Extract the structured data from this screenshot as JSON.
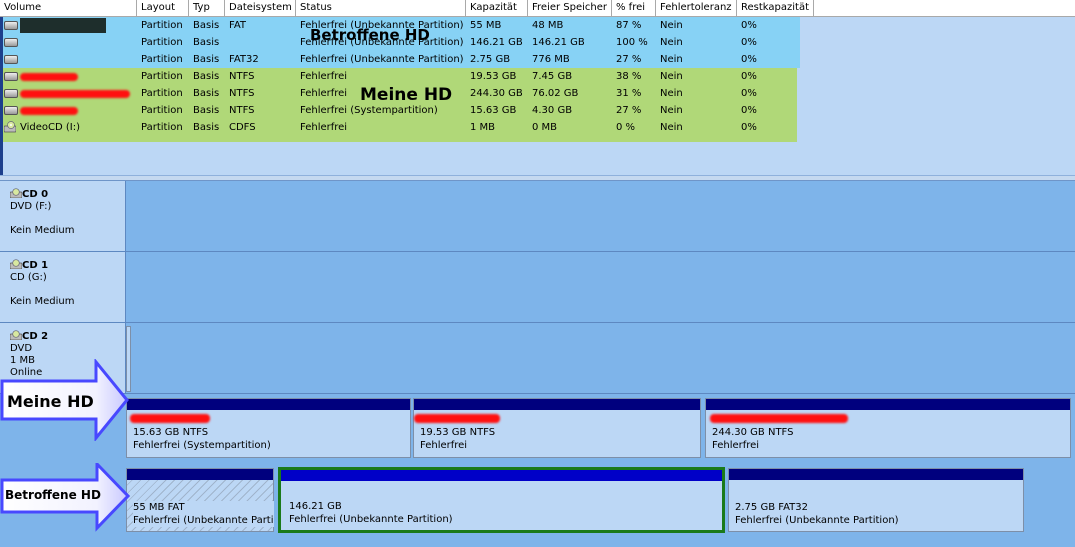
{
  "columns": [
    "Volume",
    "Layout",
    "Typ",
    "Dateisystem",
    "Status",
    "Kapazität",
    "Freier Speicher",
    "% frei",
    "Fehlertoleranz",
    "Restkapazität"
  ],
  "volumes": [
    {
      "volume": "",
      "layout": "Partition",
      "type": "Basis",
      "fs": "FAT",
      "status": "Fehlerfrei (Unbekannte Partition)",
      "capacity": "55 MB",
      "free": "48 MB",
      "pct": "87 %",
      "fault": "Nein",
      "overhead": "0%"
    },
    {
      "volume": "",
      "layout": "Partition",
      "type": "Basis",
      "fs": "",
      "status": "Fehlerfrei (Unbekannte Partition)",
      "capacity": "146.21 GB",
      "free": "146.21 GB",
      "pct": "100 %",
      "fault": "Nein",
      "overhead": "0%"
    },
    {
      "volume": "",
      "layout": "Partition",
      "type": "Basis",
      "fs": "FAT32",
      "status": "Fehlerfrei (Unbekannte Partition)",
      "capacity": "2.75 GB",
      "free": "776 MB",
      "pct": "27 %",
      "fault": "Nein",
      "overhead": "0%"
    },
    {
      "volume": "",
      "layout": "Partition",
      "type": "Basis",
      "fs": "NTFS",
      "status": "Fehlerfrei",
      "capacity": "19.53 GB",
      "free": "7.45 GB",
      "pct": "38 %",
      "fault": "Nein",
      "overhead": "0%"
    },
    {
      "volume": "",
      "layout": "Partition",
      "type": "Basis",
      "fs": "NTFS",
      "status": "Fehlerfrei",
      "capacity": "244.30 GB",
      "free": "76.02 GB",
      "pct": "31 %",
      "fault": "Nein",
      "overhead": "0%"
    },
    {
      "volume": "",
      "layout": "Partition",
      "type": "Basis",
      "fs": "NTFS",
      "status": "Fehlerfrei (Systempartition)",
      "capacity": "15.63 GB",
      "free": "4.30 GB",
      "pct": "27 %",
      "fault": "Nein",
      "overhead": "0%"
    },
    {
      "volume": "VideoCD (I:)",
      "layout": "Partition",
      "type": "Basis",
      "fs": "CDFS",
      "status": "Fehlerfrei",
      "capacity": "1 MB",
      "free": "0 MB",
      "pct": "0 %",
      "fault": "Nein",
      "overhead": "0%"
    }
  ],
  "overlay": {
    "betroffene": "Betroffene HD",
    "meine": "Meine HD"
  },
  "disks": [
    {
      "title": "CD 0",
      "line1": "DVD (F:)",
      "line2": "",
      "line3": "Kein Medium"
    },
    {
      "title": "CD 1",
      "line1": "CD (G:)",
      "line2": "",
      "line3": "Kein Medium"
    },
    {
      "title": "CD 2",
      "line1": "DVD",
      "line2": "1 MB",
      "line3": "Online"
    }
  ],
  "meine_parts": [
    {
      "size": "15.63 GB NTFS",
      "status": "Fehlerfrei (Systempartition)"
    },
    {
      "size": "19.53 GB NTFS",
      "status": "Fehlerfrei"
    },
    {
      "size": "244.30 GB NTFS",
      "status": "Fehlerfrei"
    }
  ],
  "betroffene_parts": [
    {
      "size": "55 MB FAT",
      "status": "Fehlerfrei (Unbekannte Parti"
    },
    {
      "size": "146.21 GB",
      "status": "Fehlerfrei (Unbekannte Partition)"
    },
    {
      "size": "2.75 GB FAT32",
      "status": "Fehlerfrei (Unbekannte Partition)"
    }
  ],
  "arrows": {
    "meine": "Meine HD",
    "betroffene": "Betroffene HD"
  },
  "colors": {
    "cyan_band": "#87d2f5",
    "green_band": "#b0d878",
    "partition_bar": "#00007e",
    "selection": "#1a7a1a"
  }
}
